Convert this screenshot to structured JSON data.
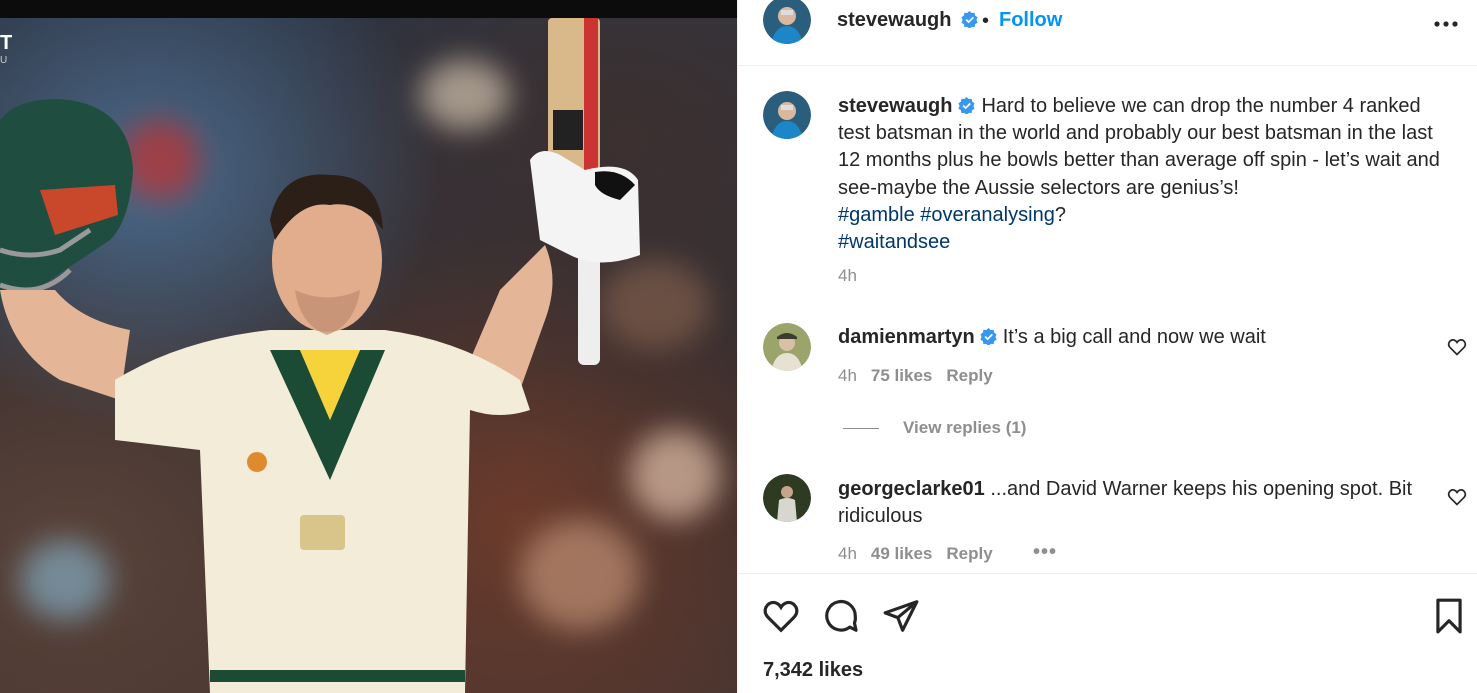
{
  "photo": {
    "alt_icon": "cricket-batsman-photo",
    "corner_mark": "T",
    "corner_sub": "U"
  },
  "header": {
    "username": "stevewaugh",
    "separator": "•",
    "follow_label": "Follow",
    "more_icon": "more-horizontal-icon"
  },
  "caption": {
    "username": "stevewaugh",
    "text": "Hard to believe we can drop the number 4 ranked test batsman in the world and probably our best batsman in the last 12 months plus he bowls better than average off spin - let’s wait and see-maybe the Aussie selectors are genius’s!",
    "tag1": "#gamble",
    "tag2": "#overanalysing",
    "tag2_suffix": "?",
    "tag3": "#waitandsee",
    "time": "4h"
  },
  "comments": [
    {
      "username": "damienmartyn",
      "text": "It’s a big call and now we wait",
      "time": "4h",
      "likes": "75 likes",
      "reply": "Reply"
    },
    {
      "username": "georgeclarke01",
      "text": "...and David Warner keeps his opening spot. Bit ridiculous",
      "time": "4h",
      "likes": "49 likes",
      "reply": "Reply",
      "more": "•••"
    }
  ],
  "view_replies": "View replies (1)",
  "actions": {
    "like_icon": "heart-icon",
    "comment_icon": "comment-icon",
    "share_icon": "share-icon",
    "save_icon": "bookmark-icon"
  },
  "likes_total": "7,342 likes",
  "colors": {
    "link": "#0095f6",
    "hashtag": "#00376b",
    "muted": "#8e8e8e",
    "verified": "#3897f0"
  }
}
